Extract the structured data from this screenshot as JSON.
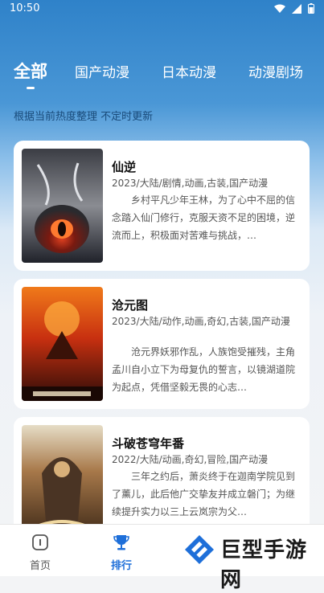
{
  "status": {
    "time": "10:50"
  },
  "tabs": [
    {
      "label": "全部",
      "active": true
    },
    {
      "label": "国产动漫",
      "active": false
    },
    {
      "label": "日本动漫",
      "active": false
    },
    {
      "label": "动漫剧场",
      "active": false
    }
  ],
  "subtitle": "根据当前热度整理 不定时更新",
  "items": [
    {
      "title": "仙逆",
      "tags": "2023/大陆/剧情,动画,古装,国产动漫",
      "desc": "乡村平凡少年王林，为了心中不屈的信念踏入仙门修行，克服天资不足的困境，逆流而上，积极面对苦难与挑战，…"
    },
    {
      "title": "沧元图",
      "tags": "2023/大陆/动作,动画,奇幻,古装,国产动漫",
      "desc": "沧元界妖邪作乱，人族饱受摧残，主角孟川自小立下为母复仇的誓言，以镜湖道院为起点，凭借坚毅无畏的心志…"
    },
    {
      "title": "斗破苍穹年番",
      "tags": "2022/大陆/动画,奇幻,冒险,国产动漫",
      "desc": "三年之约后，萧炎终于在迦南学院见到了薰儿，此后他广交挚友并成立磐门；为继续提升实力以三上云岚宗为父…"
    }
  ],
  "nav": [
    {
      "label": "首页",
      "active": false
    },
    {
      "label": "排行",
      "active": true
    }
  ],
  "watermark": "巨型手游网",
  "colors": {
    "accent": "#1e6fd9",
    "nav_inactive": "#555555"
  }
}
